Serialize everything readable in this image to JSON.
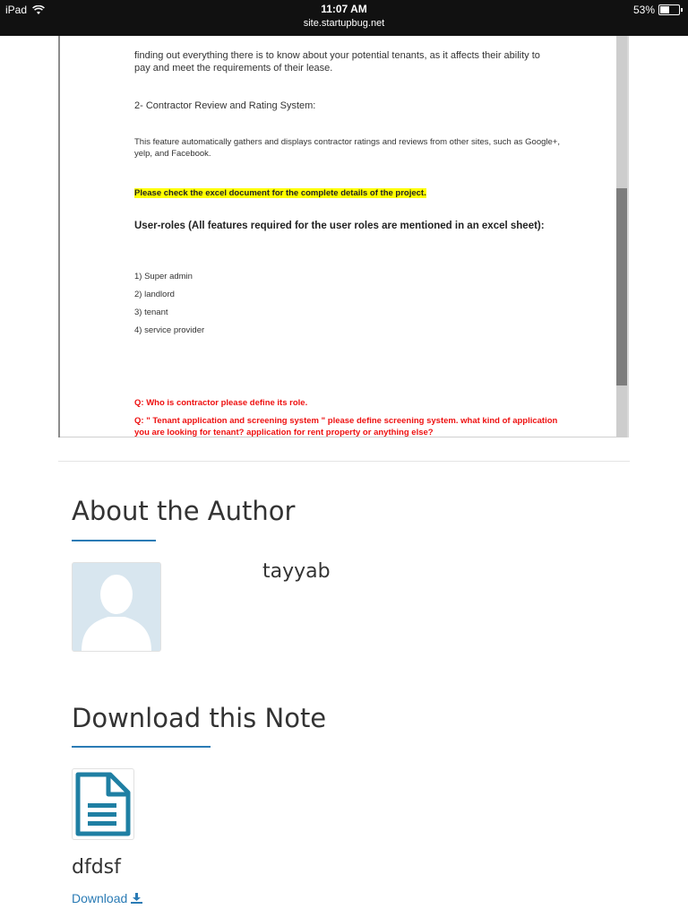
{
  "status_bar": {
    "device": "iPad",
    "time": "11:07 AM",
    "url": "site.startupbug.net",
    "battery": "53%",
    "battery_level": 0.53
  },
  "document": {
    "para1": "finding out everything there is to know about your potential tenants, as it affects their ability to pay and meet the requirements of their lease.",
    "heading2": "2- Contractor Review and Rating System:",
    "para2": "This feature automatically gathers and displays contractor ratings and reviews from other sites, such as Google+, yelp, and Facebook.",
    "highlight": "Please check the excel document for the complete details of the project.",
    "roles_heading": "User-roles (All features required for the user roles are mentioned in an excel sheet):",
    "roles": [
      "1) Super admin",
      "2) landlord",
      "3) tenant",
      "4) service provider"
    ],
    "question1": "Q: Who is contractor please define its role.",
    "question2": "Q: \" Tenant application and screening system \" please define screening system. what kind of application you are looking for tenant? application for rent property or anything else?"
  },
  "author_section": {
    "title": "About the Author",
    "name": "tayyab"
  },
  "download_section": {
    "title": "Download this Note",
    "file_name": "dfdsf",
    "link_label": "Download"
  },
  "colors": {
    "accent": "#2a7bb5",
    "highlight": "#ffff00",
    "question_red": "#ee1111"
  },
  "icons": {
    "wifi": "wifi-icon",
    "battery": "battery-icon",
    "avatar": "avatar-placeholder-icon",
    "document": "document-icon",
    "download": "download-icon"
  }
}
